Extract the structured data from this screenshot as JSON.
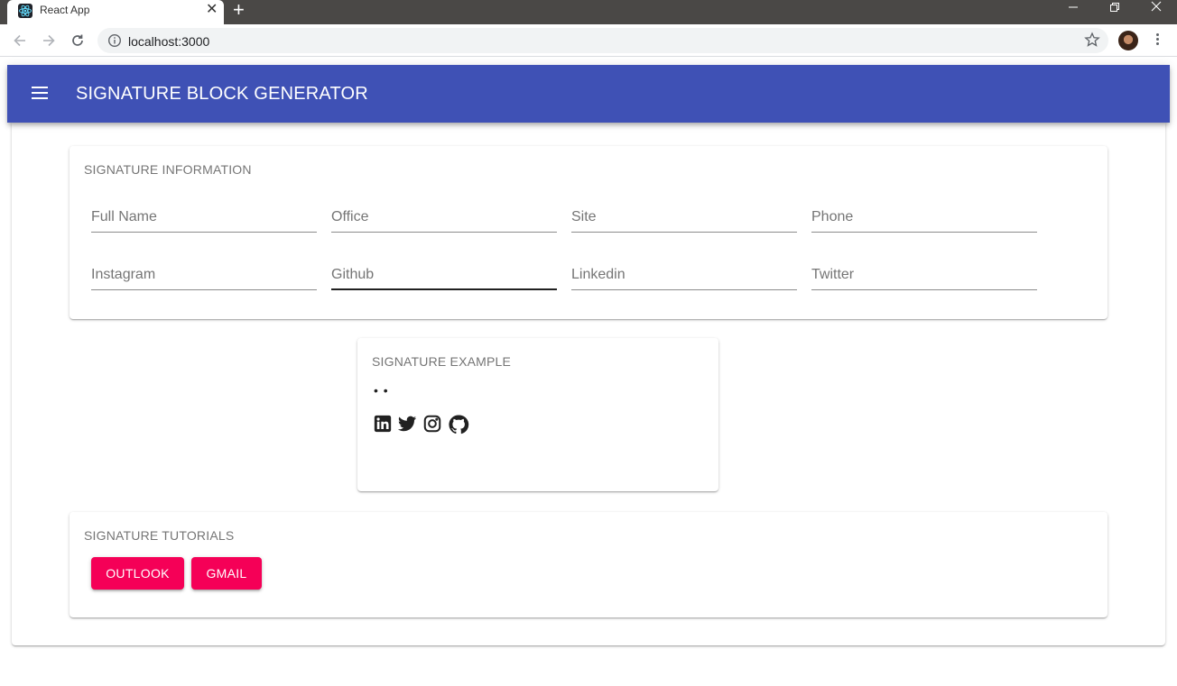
{
  "browser": {
    "tab_title": "React App",
    "tab_close_glyph": "✕",
    "new_tab_glyph": "+",
    "window_controls": {
      "minimize": "—",
      "restore": "❐",
      "close": "✕"
    },
    "url": "localhost:3000",
    "icons": [
      "react-favicon-icon",
      "back-arrow-icon",
      "forward-arrow-icon",
      "reload-icon",
      "info-icon",
      "star-icon",
      "profile-avatar",
      "more-vert-icon"
    ]
  },
  "app_bar": {
    "title": "SIGNATURE BLOCK GENERATOR",
    "color": "#3f51b5",
    "menu_icon": "hamburger-menu-icon"
  },
  "signature_information": {
    "heading": "SIGNATURE INFORMATION",
    "fields": [
      {
        "placeholder": "Full Name",
        "value": ""
      },
      {
        "placeholder": "Office",
        "value": ""
      },
      {
        "placeholder": "Site",
        "value": ""
      },
      {
        "placeholder": "Phone",
        "value": ""
      },
      {
        "placeholder": "Instagram",
        "value": ""
      },
      {
        "placeholder": "Github",
        "value": "",
        "focused": true
      },
      {
        "placeholder": "Linkedin",
        "value": ""
      },
      {
        "placeholder": "Twitter",
        "value": ""
      }
    ]
  },
  "signature_example": {
    "heading": "SIGNATURE EXAMPLE",
    "separator_text": "• •",
    "social_icons": [
      "linkedin-icon",
      "twitter-icon",
      "instagram-icon",
      "github-icon"
    ]
  },
  "signature_tutorials": {
    "heading": "SIGNATURE TUTORIALS",
    "buttons": [
      {
        "label": "OUTLOOK"
      },
      {
        "label": "GMAIL"
      }
    ],
    "button_color": "#f50057"
  }
}
